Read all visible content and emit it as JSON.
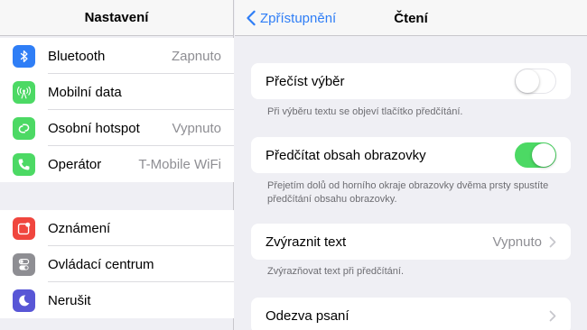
{
  "sidebar": {
    "title": "Nastavení",
    "group1": [
      {
        "label": "Bluetooth",
        "value": "Zapnuto",
        "icon": "bluetooth-icon",
        "color": "#2f7ef6"
      },
      {
        "label": "Mobilní data",
        "value": "",
        "icon": "antenna-icon",
        "color": "#4cd964"
      },
      {
        "label": "Osobní hotspot",
        "value": "Vypnuto",
        "icon": "hotspot-icon",
        "color": "#4cd964"
      },
      {
        "label": "Operátor",
        "value": "T-Mobile WiFi",
        "icon": "phone-icon",
        "color": "#4cd964"
      }
    ],
    "group2": [
      {
        "label": "Oznámení",
        "value": "",
        "icon": "notifications-icon",
        "color": "#f0463e"
      },
      {
        "label": "Ovládací centrum",
        "value": "",
        "icon": "control-center-icon",
        "color": "#8e8e93"
      },
      {
        "label": "Nerušit",
        "value": "",
        "icon": "moon-icon",
        "color": "#5856d6"
      }
    ]
  },
  "detail": {
    "back_label": "Zpřístupnění",
    "title": "Čtení",
    "speak_selection": {
      "label": "Přečíst výběr",
      "toggle_on": false,
      "footer": "Při výběru textu se objeví tlačítko předčítání."
    },
    "speak_screen": {
      "label": "Předčítat obsah obrazovky",
      "toggle_on": true,
      "footer": "Přejetím dolů od horního okraje obrazovky dvěma prsty spustíte předčítání obsahu obrazovky."
    },
    "highlight": {
      "label": "Zvýraznit text",
      "value": "Vypnuto",
      "footer": "Zvýrazňovat text při předčítání."
    },
    "typing_feedback": {
      "label": "Odezva psaní"
    }
  },
  "colors": {
    "accent": "#2f7ef6",
    "toggle_on": "#4cd964"
  }
}
